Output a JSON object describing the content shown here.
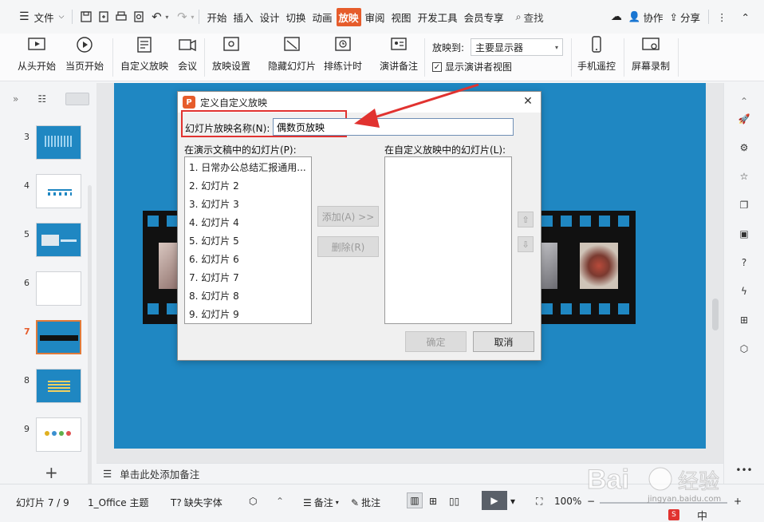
{
  "menubar": {
    "file_label": "文件",
    "tabs": [
      "开始",
      "插入",
      "设计",
      "切换",
      "动画",
      "放映",
      "审阅",
      "视图",
      "开发工具",
      "会员专享"
    ],
    "active_tab": "放映",
    "search_label": "查找",
    "collab_label": "协作",
    "share_label": "分享"
  },
  "ribbon": {
    "from_start": "从头开始",
    "from_current": "当页开始",
    "custom_show": "自定义放映",
    "meeting": "会议",
    "show_settings": "放映设置",
    "hide_slide": "隐藏幻灯片",
    "rehearse": "排练计时",
    "speaker_notes": "演讲备注",
    "show_to_label": "放映到:",
    "show_to_value": "主要显示器",
    "presenter_view": "显示演讲者视图",
    "phone_remote": "手机遥控",
    "screen_record": "屏幕录制"
  },
  "thumbnails": {
    "slides": [
      {
        "num": "3"
      },
      {
        "num": "4"
      },
      {
        "num": "5"
      },
      {
        "num": "6"
      },
      {
        "num": "7",
        "active": true
      },
      {
        "num": "8"
      },
      {
        "num": "9"
      }
    ]
  },
  "notes": {
    "placeholder": "单击此处添加备注"
  },
  "statusbar": {
    "slide_count": "幻灯片 7 / 9",
    "theme": "1_Office 主题",
    "missing_font": "缺失字体",
    "notes_btn": "备注",
    "comments_btn": "批注",
    "zoom": "100%"
  },
  "dialog": {
    "title": "定义自定义放映",
    "name_label": "幻灯片放映名称(N):",
    "name_value": "偶数页放映",
    "left_list_label": "在演示文稿中的幻灯片(P):",
    "right_list_label": "在自定义放映中的幻灯片(L):",
    "slides": [
      "1. 日常办公总结汇报通用...",
      "2. 幻灯片 2",
      "3. 幻灯片 3",
      "4. 幻灯片 4",
      "5. 幻灯片 5",
      "6. 幻灯片 6",
      "7. 幻灯片 7",
      "8. 幻灯片 8",
      "9. 幻灯片 9"
    ],
    "add_btn": "添加(A) >>",
    "delete_btn": "删除(R)",
    "ok_btn": "确定",
    "cancel_btn": "取消"
  },
  "colors": {
    "accent": "#e65c2b",
    "slide_bg": "#1f87c2",
    "highlight": "#e1322f"
  },
  "watermark": {
    "brand": "Bai",
    "brand2": "经验",
    "url": "jingyan.baidu.com",
    "tray": "中"
  }
}
